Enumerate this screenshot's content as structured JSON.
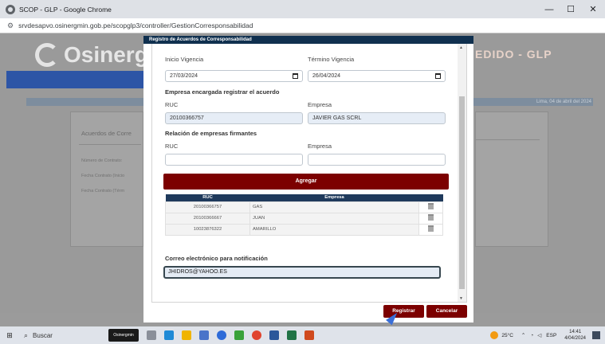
{
  "browser": {
    "window_title": "SCOP - GLP - Google Chrome",
    "url": "srvdesapvo.osinergmin.gob.pe/scopglp3/controller/GestionCorresponsabilidad",
    "minimize": "—",
    "maximize": "☐",
    "close": "✕"
  },
  "background": {
    "logo_text": "Osinerg",
    "header_right": "EDIDO - GLP",
    "date_text": "Lima, 04 de abril del 2024",
    "card_title": "Acuerdos de Corre",
    "field1": "Número de Contrato:",
    "field2": "Fecha Contrato (Inicio",
    "field3": "Fecha Contrato (Térm"
  },
  "modal": {
    "title": "Registro de Acuerdos de Corresponsabilidad",
    "inicio_label": "Inicio Vigencia",
    "inicio_value": "27/03/2024",
    "termino_label": "Término Vigencia",
    "termino_value": "26/04/2024",
    "encargada_heading": "Empresa encargada registrar el acuerdo",
    "ruc_label": "RUC",
    "empresa_label": "Empresa",
    "ruc_value": "20100366757",
    "empresa_value": "JAVIER GAS SCRL",
    "firmantes_heading": "Relación de empresas firmantes",
    "ruc_label2": "RUC",
    "empresa_label2": "Empresa",
    "ruc_input": "",
    "empresa_input": "",
    "add_button": "Agregar",
    "table": {
      "headers": [
        "RUC",
        "Empresa"
      ],
      "rows": [
        {
          "ruc": "20100366757",
          "empresa": "GAS"
        },
        {
          "ruc": "20100366667",
          "empresa": "JUAN"
        },
        {
          "ruc": "10023876322",
          "empresa": "AMARILLO"
        }
      ]
    },
    "email_label": "Correo electrónico para notificación",
    "email_value": "JHIDROS@YAHOO.ES",
    "register_button": "Registrar",
    "cancel_button": "Cancelar"
  },
  "taskbar": {
    "search_label": "Buscar",
    "pinned_app": "Osinergmin",
    "temperature": "25°C",
    "language": "ESP",
    "time": "14:41",
    "date": "4/04/2024"
  }
}
